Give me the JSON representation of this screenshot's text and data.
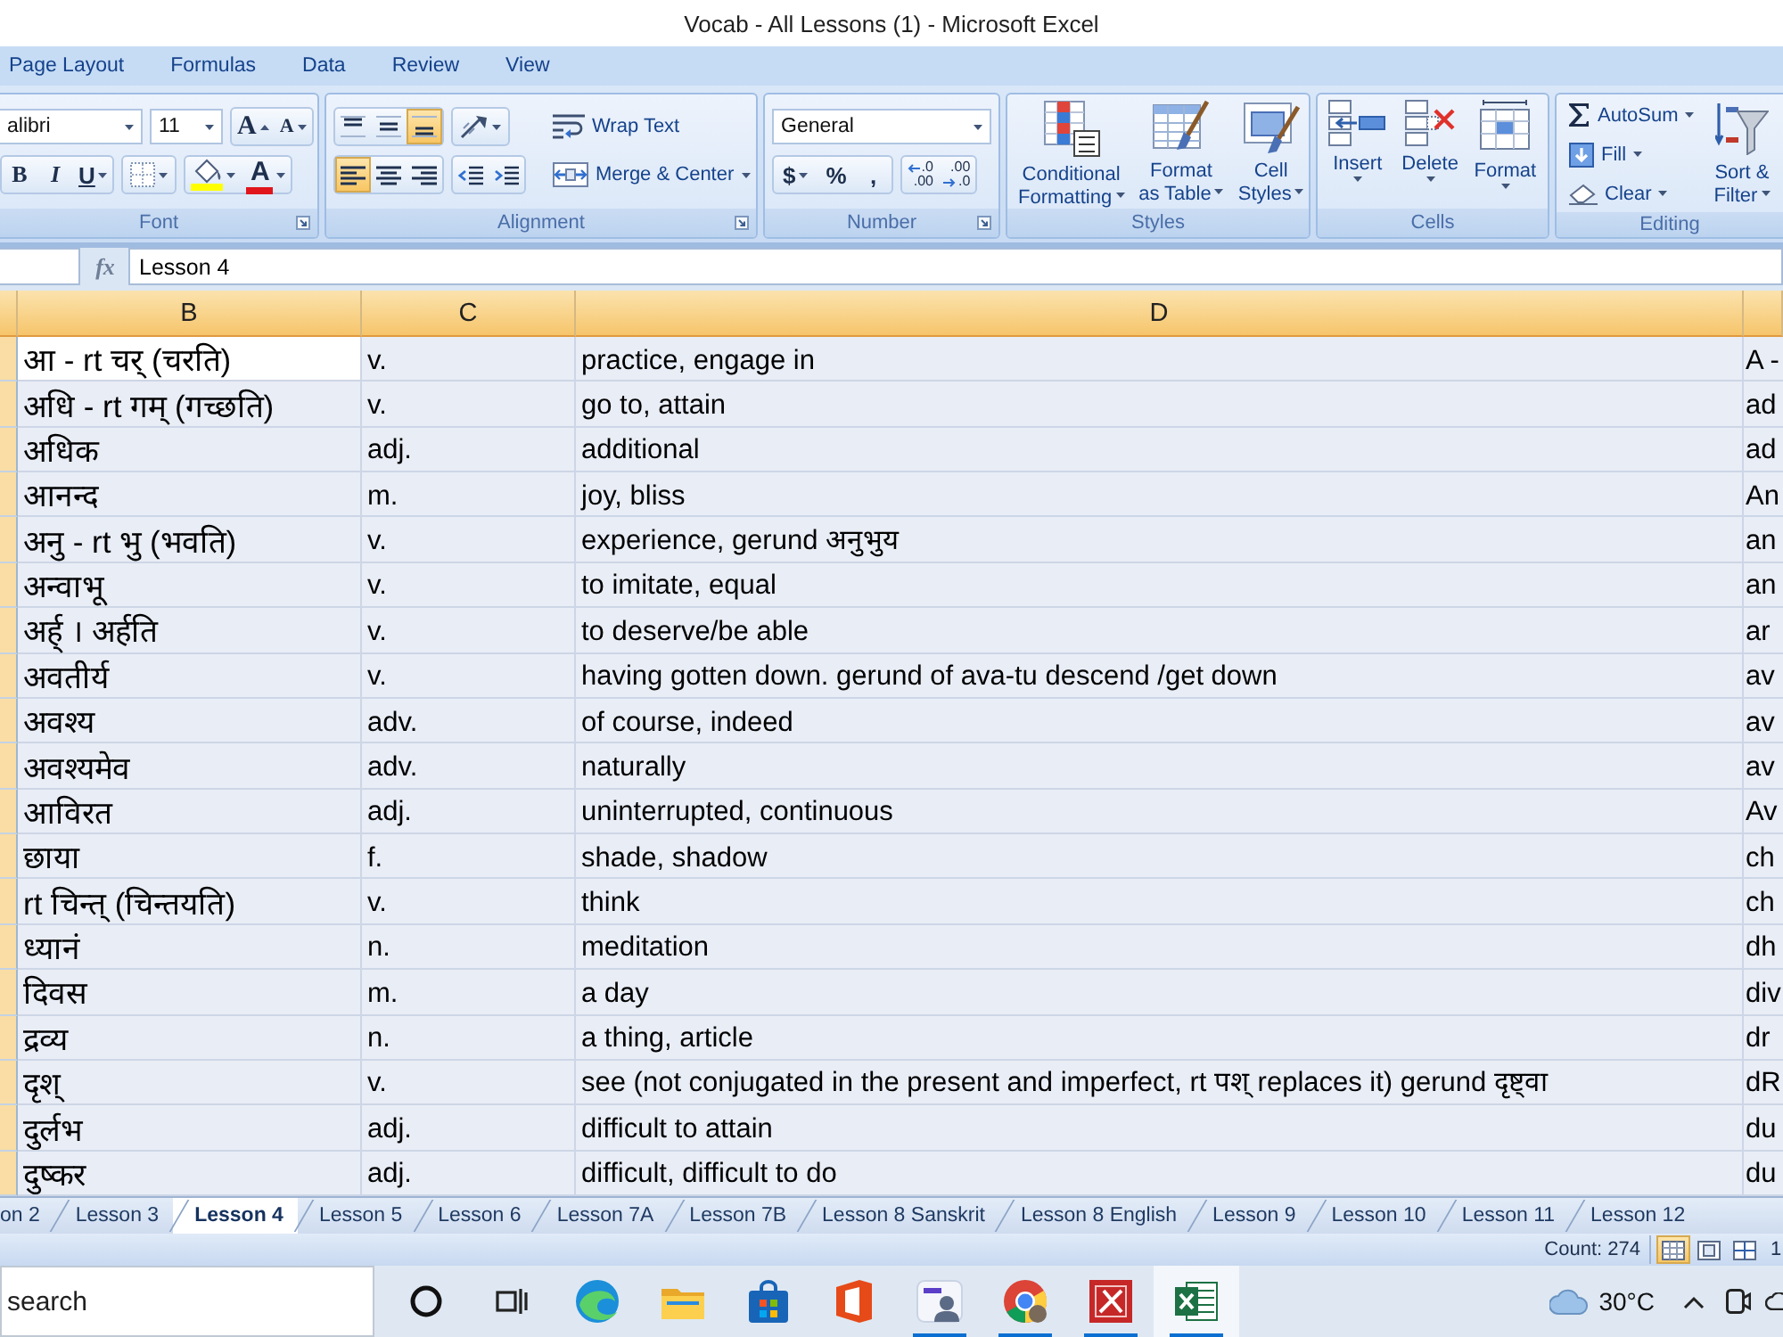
{
  "window": {
    "title": "Vocab - All Lessons (1) - Microsoft Excel"
  },
  "ribbon_tabs": [
    {
      "label": "Page Layout",
      "selected": false
    },
    {
      "label": "Formulas",
      "selected": false
    },
    {
      "label": "Data",
      "selected": false
    },
    {
      "label": "Review",
      "selected": false
    },
    {
      "label": "View",
      "selected": false
    }
  ],
  "ribbon": {
    "font": {
      "label": "Font",
      "launcher": true,
      "font_name": "alibri",
      "font_size": "11",
      "grow": "A",
      "shrink": "A",
      "styles": [
        {
          "kind": "bold",
          "label": "B"
        },
        {
          "kind": "italic",
          "label": "I"
        },
        {
          "kind": "underline",
          "label": "U"
        }
      ],
      "font_color": "A"
    },
    "alignment": {
      "label": "Alignment",
      "launcher": true,
      "vertical": [
        {
          "kind": "top",
          "selected": false
        },
        {
          "kind": "middle",
          "selected": false
        },
        {
          "kind": "bottom",
          "selected": true
        }
      ],
      "horizontal": [
        {
          "kind": "left",
          "selected": true
        },
        {
          "kind": "center",
          "selected": false
        },
        {
          "kind": "right",
          "selected": false
        }
      ],
      "wrap_text": "Wrap Text",
      "merge_center": "Merge & Center"
    },
    "number": {
      "label": "Number",
      "launcher": true,
      "format": "General",
      "buttons": [
        {
          "kind": "currency",
          "label": "$"
        },
        {
          "kind": "percent",
          "label": "%"
        },
        {
          "kind": "comma",
          "label": ","
        }
      ],
      "decimals": [
        {
          "kind": "increase",
          "lines": [
            ".0",
            ".00"
          ]
        },
        {
          "kind": "decrease",
          "lines": [
            ".00",
            ".0"
          ]
        }
      ]
    },
    "styles": {
      "label": "Styles",
      "buttons": [
        {
          "kind": "conditional",
          "lines": [
            "Conditional",
            "Formatting"
          ]
        },
        {
          "kind": "table",
          "lines": [
            "Format",
            "as Table"
          ]
        },
        {
          "kind": "cell",
          "lines": [
            "Cell",
            "Styles"
          ]
        }
      ]
    },
    "cells": {
      "label": "Cells",
      "buttons": [
        {
          "kind": "insert",
          "label": "Insert"
        },
        {
          "kind": "delete",
          "label": "Delete"
        },
        {
          "kind": "format",
          "label": "Format"
        }
      ]
    },
    "editing": {
      "label": "Editing",
      "items": [
        {
          "kind": "autosum",
          "label": "AutoSum"
        },
        {
          "kind": "fill",
          "label": "Fill"
        },
        {
          "kind": "clear",
          "label": "Clear"
        }
      ],
      "sort_filter": [
        "Sort &",
        "Filter"
      ]
    }
  },
  "formula_bar": {
    "function_label": "fx",
    "value": "Lesson 4"
  },
  "sheet": {
    "all_selected": true,
    "columns": [
      "B",
      "C",
      "D"
    ],
    "rows": [
      {
        "cells": [
          {
            "text": "आ - rt चर् (चरति)",
            "active": true
          },
          {
            "text": "v.",
            "active": false
          },
          {
            "text": "practice, engage in",
            "active": false
          },
          {
            "text": "A -",
            "active": false
          }
        ]
      },
      {
        "cells": [
          {
            "text": "अधि - rt गम् (गच्छति)",
            "active": false
          },
          {
            "text": "v.",
            "active": false
          },
          {
            "text": "go to, attain",
            "active": false
          },
          {
            "text": "ad",
            "active": false
          }
        ]
      },
      {
        "cells": [
          {
            "text": "अधिक",
            "active": false
          },
          {
            "text": "adj.",
            "active": false
          },
          {
            "text": "additional",
            "active": false
          },
          {
            "text": "ad",
            "active": false
          }
        ]
      },
      {
        "cells": [
          {
            "text": "आनन्द",
            "active": false
          },
          {
            "text": "m.",
            "active": false
          },
          {
            "text": "joy, bliss",
            "active": false
          },
          {
            "text": "An",
            "active": false
          }
        ]
      },
      {
        "cells": [
          {
            "text": "अनु - rt भु (भवति)",
            "active": false
          },
          {
            "text": "v.",
            "active": false
          },
          {
            "text": "experience, gerund अनुभुय",
            "active": false
          },
          {
            "text": "an",
            "active": false
          }
        ]
      },
      {
        "cells": [
          {
            "text": "अन्वाभू",
            "active": false
          },
          {
            "text": "v.",
            "active": false
          },
          {
            "text": "to imitate, equal",
            "active": false
          },
          {
            "text": "an",
            "active": false
          }
        ]
      },
      {
        "cells": [
          {
            "text": "अर्ह् । अर्हति",
            "active": false
          },
          {
            "text": "v.",
            "active": false
          },
          {
            "text": "to deserve/be able",
            "active": false
          },
          {
            "text": "ar",
            "active": false
          }
        ]
      },
      {
        "cells": [
          {
            "text": "अवतीर्य",
            "active": false
          },
          {
            "text": "v.",
            "active": false
          },
          {
            "text": "having gotten down. gerund of ava-tu descend /get down",
            "active": false
          },
          {
            "text": "av",
            "active": false
          }
        ]
      },
      {
        "cells": [
          {
            "text": "अवश्य",
            "active": false
          },
          {
            "text": "adv.",
            "active": false
          },
          {
            "text": "of course, indeed",
            "active": false
          },
          {
            "text": "av",
            "active": false
          }
        ]
      },
      {
        "cells": [
          {
            "text": "अवश्यमेव",
            "active": false
          },
          {
            "text": "adv.",
            "active": false
          },
          {
            "text": "naturally",
            "active": false
          },
          {
            "text": "av",
            "active": false
          }
        ]
      },
      {
        "cells": [
          {
            "text": "आविरत",
            "active": false
          },
          {
            "text": "adj.",
            "active": false
          },
          {
            "text": "uninterrupted, continuous",
            "active": false
          },
          {
            "text": "Av",
            "active": false
          }
        ]
      },
      {
        "cells": [
          {
            "text": "छाया",
            "active": false
          },
          {
            "text": "f.",
            "active": false
          },
          {
            "text": "shade, shadow",
            "active": false
          },
          {
            "text": "ch",
            "active": false
          }
        ]
      },
      {
        "cells": [
          {
            "text": "rt चिन्त् (चिन्तयति)",
            "active": false
          },
          {
            "text": "v.",
            "active": false
          },
          {
            "text": "think",
            "active": false
          },
          {
            "text": "ch",
            "active": false
          }
        ]
      },
      {
        "cells": [
          {
            "text": "ध्यानं",
            "active": false
          },
          {
            "text": "n.",
            "active": false
          },
          {
            "text": "meditation",
            "active": false
          },
          {
            "text": "dh",
            "active": false
          }
        ]
      },
      {
        "cells": [
          {
            "text": "दिवस",
            "active": false
          },
          {
            "text": "m.",
            "active": false
          },
          {
            "text": "a day",
            "active": false
          },
          {
            "text": "div",
            "active": false
          }
        ]
      },
      {
        "cells": [
          {
            "text": "द्रव्य",
            "active": false
          },
          {
            "text": "n.",
            "active": false
          },
          {
            "text": "a thing, article",
            "active": false
          },
          {
            "text": "dr",
            "active": false
          }
        ]
      },
      {
        "cells": [
          {
            "text": "दृश्",
            "active": false
          },
          {
            "text": "v.",
            "active": false
          },
          {
            "text": "see (not conjugated in the present and imperfect, rt पश् replaces it) gerund दृष्ट्वा",
            "active": false
          },
          {
            "text": "dR",
            "active": false
          }
        ]
      },
      {
        "cells": [
          {
            "text": "दुर्लभ",
            "active": false
          },
          {
            "text": "adj.",
            "active": false
          },
          {
            "text": "difficult to attain",
            "active": false
          },
          {
            "text": "du",
            "active": false
          }
        ]
      },
      {
        "cells": [
          {
            "text": "दुष्कर",
            "active": false
          },
          {
            "text": "adj.",
            "active": false
          },
          {
            "text": "difficult, difficult to do",
            "active": false
          },
          {
            "text": "du",
            "active": false
          }
        ]
      }
    ]
  },
  "sheet_tabs": [
    {
      "label": "on 2",
      "selected": false
    },
    {
      "label": "Lesson 3",
      "selected": false
    },
    {
      "label": "Lesson 4",
      "selected": true
    },
    {
      "label": "Lesson 5",
      "selected": false
    },
    {
      "label": "Lesson 6",
      "selected": false
    },
    {
      "label": "Lesson 7A",
      "selected": false
    },
    {
      "label": "Lesson 7B",
      "selected": false
    },
    {
      "label": "Lesson 8 Sanskrit",
      "selected": false
    },
    {
      "label": "Lesson 8 English",
      "selected": false
    },
    {
      "label": "Lesson 9",
      "selected": false
    },
    {
      "label": "Lesson 10",
      "selected": false
    },
    {
      "label": "Lesson 11",
      "selected": false
    },
    {
      "label": "Lesson 12",
      "selected": false
    }
  ],
  "status_bar": {
    "count": "Count: 274",
    "views": [
      {
        "kind": "normal",
        "selected": true
      },
      {
        "kind": "page_layout",
        "selected": false
      },
      {
        "kind": "page_break",
        "selected": false
      }
    ],
    "zoom": "1"
  },
  "taskbar": {
    "search": {
      "placeholder": "search"
    },
    "apps": [
      {
        "kind": "cortana",
        "running": false,
        "selected": false
      },
      {
        "kind": "task_view",
        "running": false,
        "selected": false
      },
      {
        "kind": "edge",
        "running": false,
        "selected": false
      },
      {
        "kind": "explorer",
        "running": false,
        "selected": false
      },
      {
        "kind": "store",
        "running": false,
        "selected": false
      },
      {
        "kind": "office",
        "running": false,
        "selected": false
      },
      {
        "kind": "meeting",
        "running": true,
        "selected": false
      },
      {
        "kind": "chrome",
        "running": true,
        "selected": false
      },
      {
        "kind": "red_app",
        "running": true,
        "selected": false
      },
      {
        "kind": "excel",
        "running": true,
        "selected": true
      }
    ],
    "temperature": "30°C"
  }
}
